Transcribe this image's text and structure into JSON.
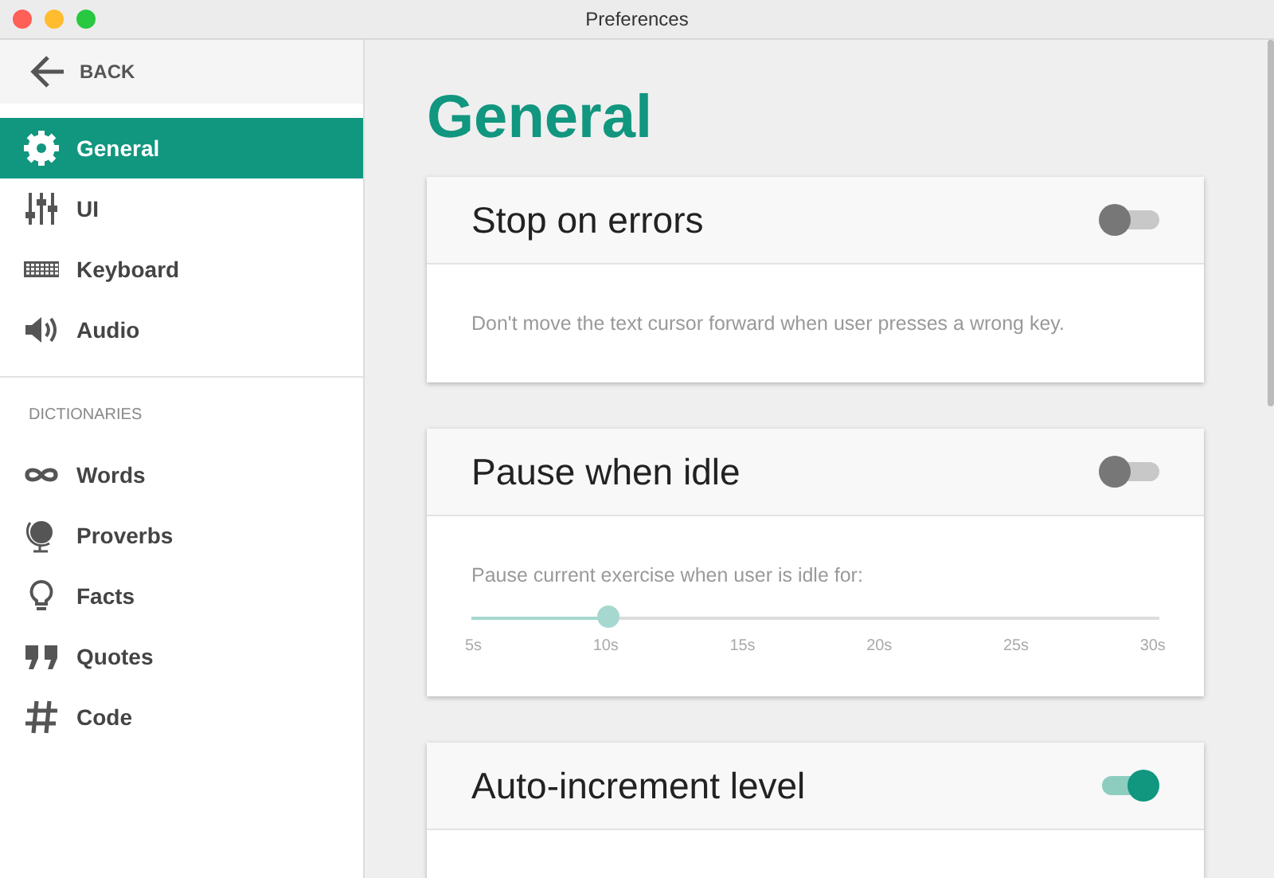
{
  "window": {
    "title": "Preferences"
  },
  "sidebar": {
    "back": "BACK",
    "items": [
      {
        "label": "General",
        "selected": true
      },
      {
        "label": "UI",
        "selected": false
      },
      {
        "label": "Keyboard",
        "selected": false
      },
      {
        "label": "Audio",
        "selected": false
      }
    ],
    "section": "DICTIONARIES",
    "dictionaries": [
      {
        "label": "Words",
        "selected": false
      },
      {
        "label": "Proverbs",
        "selected": false
      },
      {
        "label": "Facts",
        "selected": false
      },
      {
        "label": "Quotes",
        "selected": false
      },
      {
        "label": "Code",
        "selected": false
      }
    ]
  },
  "main": {
    "heading": "General",
    "cards": [
      {
        "title": "Stop on errors",
        "on": false,
        "kind": "text",
        "description": "Don't move the text cursor forward when user presses a wrong key."
      },
      {
        "title": "Pause when idle",
        "on": false,
        "kind": "slider",
        "description": "Pause current exercise when user is idle for:",
        "slider": {
          "level": 0.2,
          "disabled": true,
          "ticks": [
            "5s",
            "10s",
            "15s",
            "20s",
            "25s",
            "30s"
          ]
        }
      },
      {
        "title": "Auto-increment level",
        "on": true,
        "kind": "empty"
      }
    ]
  }
}
